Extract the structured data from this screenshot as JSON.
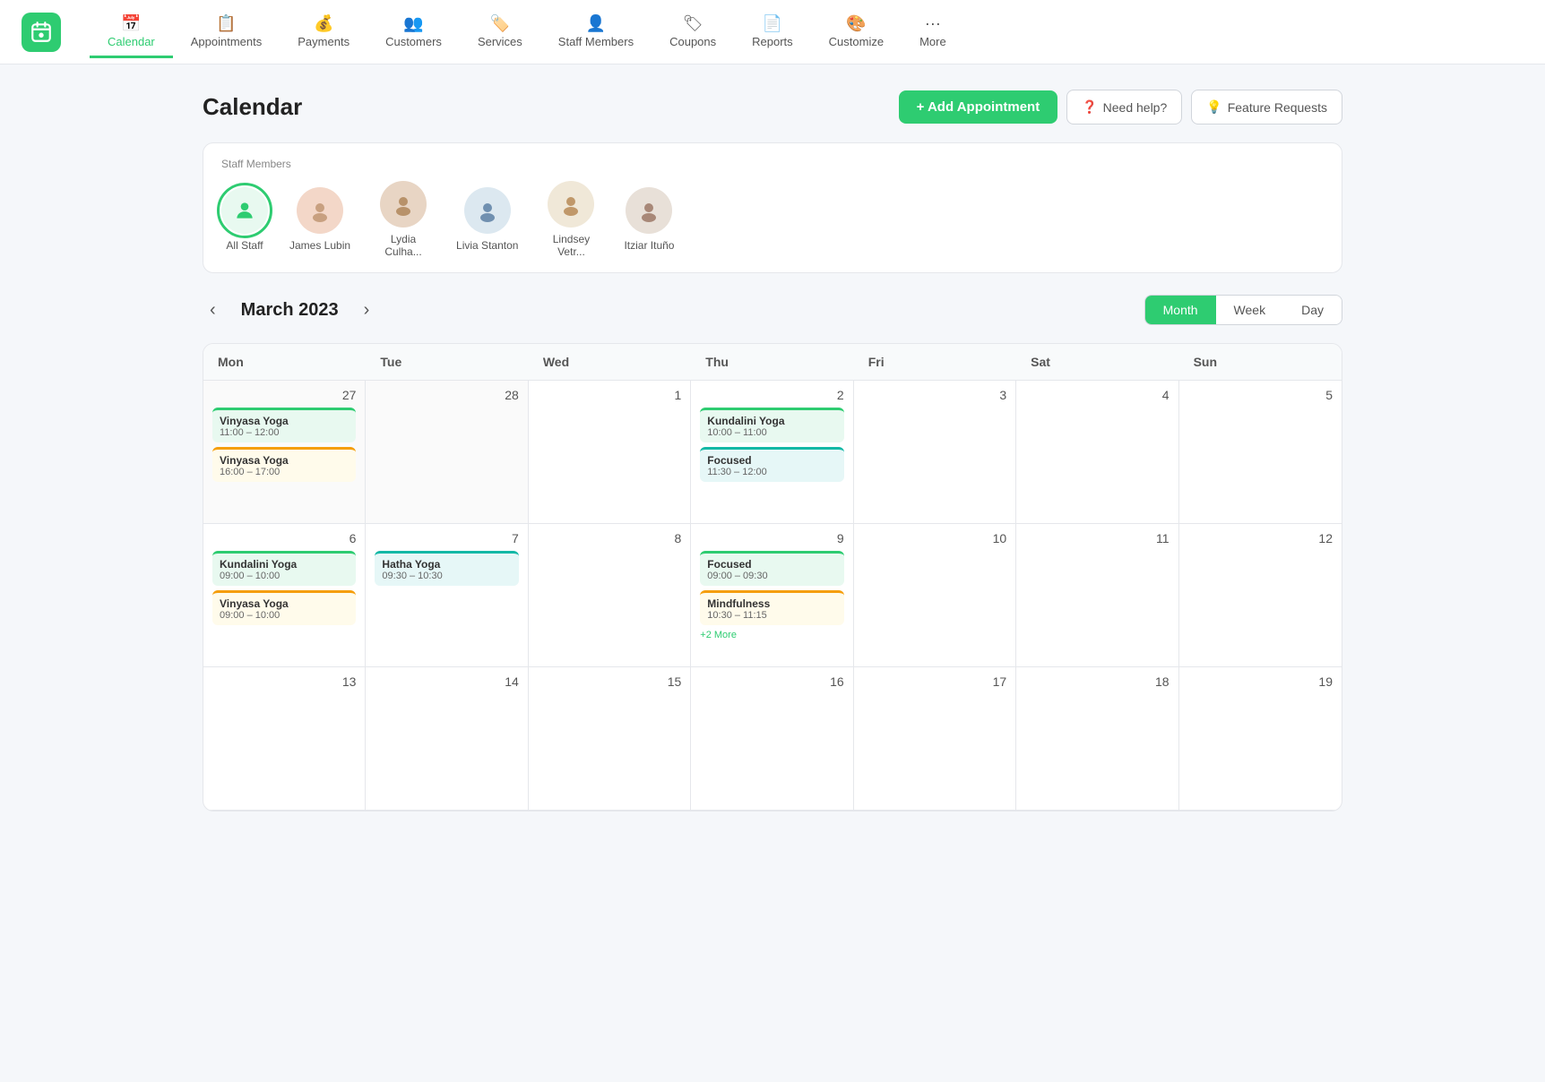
{
  "nav": {
    "logo_alt": "App logo",
    "items": [
      {
        "id": "calendar",
        "label": "Calendar",
        "icon": "📅",
        "active": true
      },
      {
        "id": "appointments",
        "label": "Appointments",
        "icon": "📋"
      },
      {
        "id": "payments",
        "label": "Payments",
        "icon": "💰"
      },
      {
        "id": "customers",
        "label": "Customers",
        "icon": "👥"
      },
      {
        "id": "services",
        "label": "Services",
        "icon": "🏷️"
      },
      {
        "id": "staff-members",
        "label": "Staff Members",
        "icon": "👤"
      },
      {
        "id": "coupons",
        "label": "Coupons",
        "icon": "🏷"
      },
      {
        "id": "reports",
        "label": "Reports",
        "icon": "📄"
      },
      {
        "id": "customize",
        "label": "Customize",
        "icon": "🎨"
      },
      {
        "id": "more",
        "label": "More",
        "icon": "···"
      }
    ]
  },
  "header": {
    "title": "Calendar",
    "add_button": "+ Add Appointment",
    "help_button": "Need help?",
    "feature_button": "Feature Requests"
  },
  "staff": {
    "label": "Staff Members",
    "members": [
      {
        "id": "all",
        "name": "All Staff",
        "active": true,
        "icon": "person"
      },
      {
        "id": "james",
        "name": "James Lubin"
      },
      {
        "id": "lydia",
        "name": "Lydia Culha..."
      },
      {
        "id": "livia",
        "name": "Livia Stanton"
      },
      {
        "id": "lindsey",
        "name": "Lindsey Vetr..."
      },
      {
        "id": "itziar",
        "name": "Itziar Ituño"
      }
    ]
  },
  "calendar": {
    "month_title": "March 2023",
    "prev_label": "‹",
    "next_label": "›",
    "views": [
      {
        "id": "month",
        "label": "Month",
        "active": true
      },
      {
        "id": "week",
        "label": "Week"
      },
      {
        "id": "day",
        "label": "Day"
      }
    ],
    "day_headers": [
      "Mon",
      "Tue",
      "Wed",
      "Thu",
      "Fri",
      "Sat",
      "Sun"
    ],
    "rows": [
      {
        "cells": [
          {
            "date": "27",
            "other": true,
            "events": [
              {
                "title": "Vinyasa Yoga",
                "time": "11:00 – 12:00",
                "color": "green"
              },
              {
                "title": "Vinyasa Yoga",
                "time": "16:00 – 17:00",
                "color": "yellow"
              }
            ]
          },
          {
            "date": "28",
            "other": true,
            "events": []
          },
          {
            "date": "1",
            "events": []
          },
          {
            "date": "2",
            "events": [
              {
                "title": "Kundalini Yoga",
                "time": "10:00 – 11:00",
                "color": "green"
              },
              {
                "title": "Focused",
                "time": "11:30 – 12:00",
                "color": "teal"
              }
            ]
          },
          {
            "date": "3",
            "events": []
          },
          {
            "date": "4",
            "events": []
          },
          {
            "date": "5",
            "events": []
          }
        ]
      },
      {
        "cells": [
          {
            "date": "6",
            "events": [
              {
                "title": "Kundalini Yoga",
                "time": "09:00 – 10:00",
                "color": "green"
              },
              {
                "title": "Vinyasa Yoga",
                "time": "09:00 – 10:00",
                "color": "yellow"
              }
            ]
          },
          {
            "date": "7",
            "events": [
              {
                "title": "Hatha Yoga",
                "time": "09:30 – 10:30",
                "color": "teal"
              }
            ]
          },
          {
            "date": "8",
            "events": []
          },
          {
            "date": "9",
            "events": [
              {
                "title": "Focused",
                "time": "09:00 – 09:30",
                "color": "green"
              },
              {
                "title": "Mindfulness",
                "time": "10:30 – 11:15",
                "color": "yellow"
              },
              {
                "more": "+2 More"
              }
            ]
          },
          {
            "date": "10",
            "events": []
          },
          {
            "date": "11",
            "events": []
          },
          {
            "date": "12",
            "events": []
          }
        ]
      },
      {
        "cells": [
          {
            "date": "13",
            "events": []
          },
          {
            "date": "14",
            "events": []
          },
          {
            "date": "15",
            "events": []
          },
          {
            "date": "16",
            "events": []
          },
          {
            "date": "17",
            "events": []
          },
          {
            "date": "18",
            "events": []
          },
          {
            "date": "19",
            "events": []
          }
        ]
      }
    ]
  }
}
